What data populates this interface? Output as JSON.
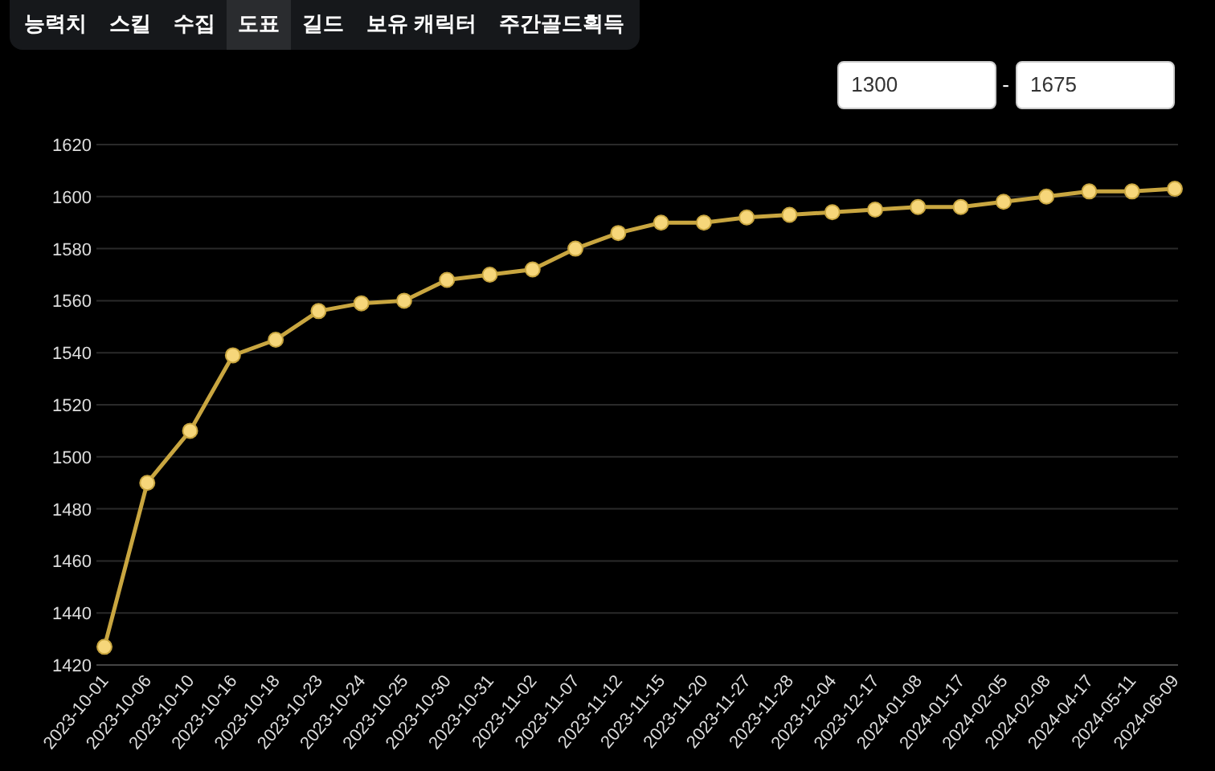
{
  "tabs": [
    {
      "label": "능력치",
      "selected": false
    },
    {
      "label": "스킬",
      "selected": false
    },
    {
      "label": "수집",
      "selected": false
    },
    {
      "label": "도표",
      "selected": true
    },
    {
      "label": "길드",
      "selected": false
    },
    {
      "label": "보유 캐릭터",
      "selected": false
    },
    {
      "label": "주간골드획득",
      "selected": false
    }
  ],
  "range": {
    "min": "1300",
    "separator": "-",
    "max": "1675"
  },
  "chart_data": {
    "type": "line",
    "categories": [
      "2023-10-01",
      "2023-10-06",
      "2023-10-10",
      "2023-10-16",
      "2023-10-18",
      "2023-10-23",
      "2023-10-24",
      "2023-10-25",
      "2023-10-30",
      "2023-10-31",
      "2023-11-02",
      "2023-11-07",
      "2023-11-12",
      "2023-11-15",
      "2023-11-20",
      "2023-11-27",
      "2023-11-28",
      "2023-12-04",
      "2023-12-17",
      "2024-01-08",
      "2024-01-17",
      "2024-02-05",
      "2024-02-08",
      "2024-04-17",
      "2024-05-11",
      "2024-06-09"
    ],
    "grid": true,
    "series": [
      {
        "color": "#c9a640",
        "marker": true,
        "values": [
          1427,
          1490,
          1510,
          1539,
          1545,
          1556,
          1559,
          1560,
          1568,
          1570,
          1572,
          1580,
          1586,
          1590,
          1590,
          1592,
          1593,
          1594,
          1595,
          1596,
          1596,
          1598,
          1600,
          1602,
          1602,
          1603
        ]
      }
    ],
    "ylim": [
      1420,
      1620
    ],
    "yticks": [
      1420,
      1440,
      1460,
      1480,
      1500,
      1520,
      1540,
      1560,
      1580,
      1600,
      1620
    ]
  }
}
